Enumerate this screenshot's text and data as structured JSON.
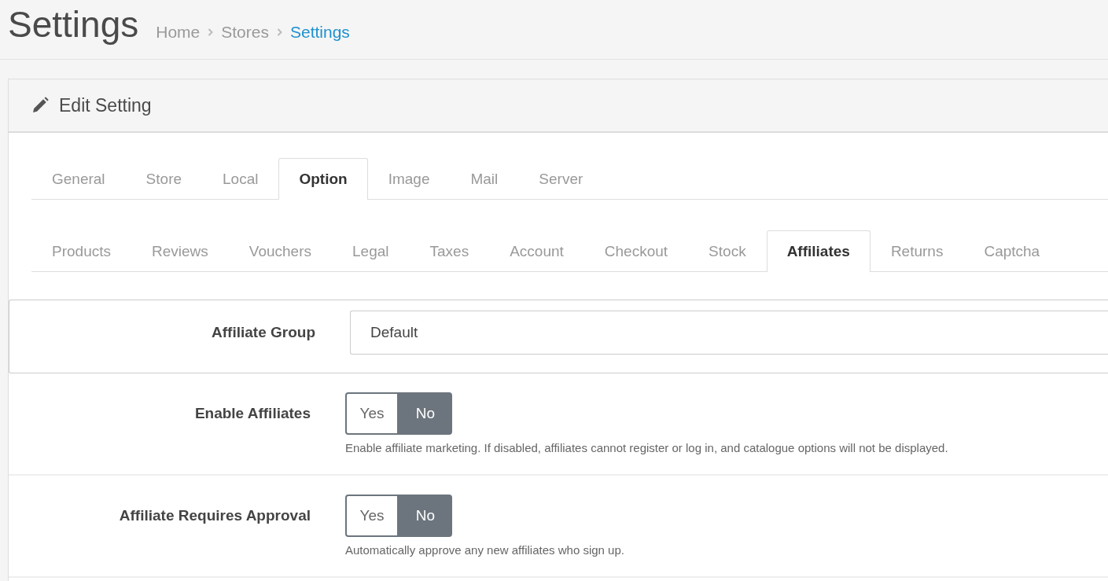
{
  "page": {
    "title": "Settings"
  },
  "breadcrumb": [
    {
      "label": "Home",
      "selected": false
    },
    {
      "label": "Stores",
      "selected": false
    },
    {
      "label": "Settings",
      "selected": true
    }
  ],
  "panel": {
    "title": "Edit Setting"
  },
  "tabs": [
    {
      "label": "General",
      "selected": false
    },
    {
      "label": "Store",
      "selected": false
    },
    {
      "label": "Local",
      "selected": false
    },
    {
      "label": "Option",
      "selected": true
    },
    {
      "label": "Image",
      "selected": false
    },
    {
      "label": "Mail",
      "selected": false
    },
    {
      "label": "Server",
      "selected": false
    }
  ],
  "subtabs": [
    {
      "label": "Products",
      "selected": false
    },
    {
      "label": "Reviews",
      "selected": false
    },
    {
      "label": "Vouchers",
      "selected": false
    },
    {
      "label": "Legal",
      "selected": false
    },
    {
      "label": "Taxes",
      "selected": false
    },
    {
      "label": "Account",
      "selected": false
    },
    {
      "label": "Checkout",
      "selected": false
    },
    {
      "label": "Stock",
      "selected": false
    },
    {
      "label": "Affiliates",
      "selected": true
    },
    {
      "label": "Returns",
      "selected": false
    },
    {
      "label": "Captcha",
      "selected": false
    }
  ],
  "fields": [
    {
      "kind": "select",
      "label": "Affiliate Group",
      "value": "Default"
    },
    {
      "kind": "toggle",
      "label": "Enable Affiliates",
      "options": [
        {
          "label": "Yes",
          "selected": false
        },
        {
          "label": "No",
          "selected": true
        }
      ],
      "help": "Enable affiliate marketing. If disabled, affiliates cannot register or log in, and catalogue options will not be displayed."
    },
    {
      "kind": "toggle",
      "label": "Affiliate Requires Approval",
      "options": [
        {
          "label": "Yes",
          "selected": false
        },
        {
          "label": "No",
          "selected": true
        }
      ],
      "help": "Automatically approve any new affiliates who sign up."
    }
  ]
}
